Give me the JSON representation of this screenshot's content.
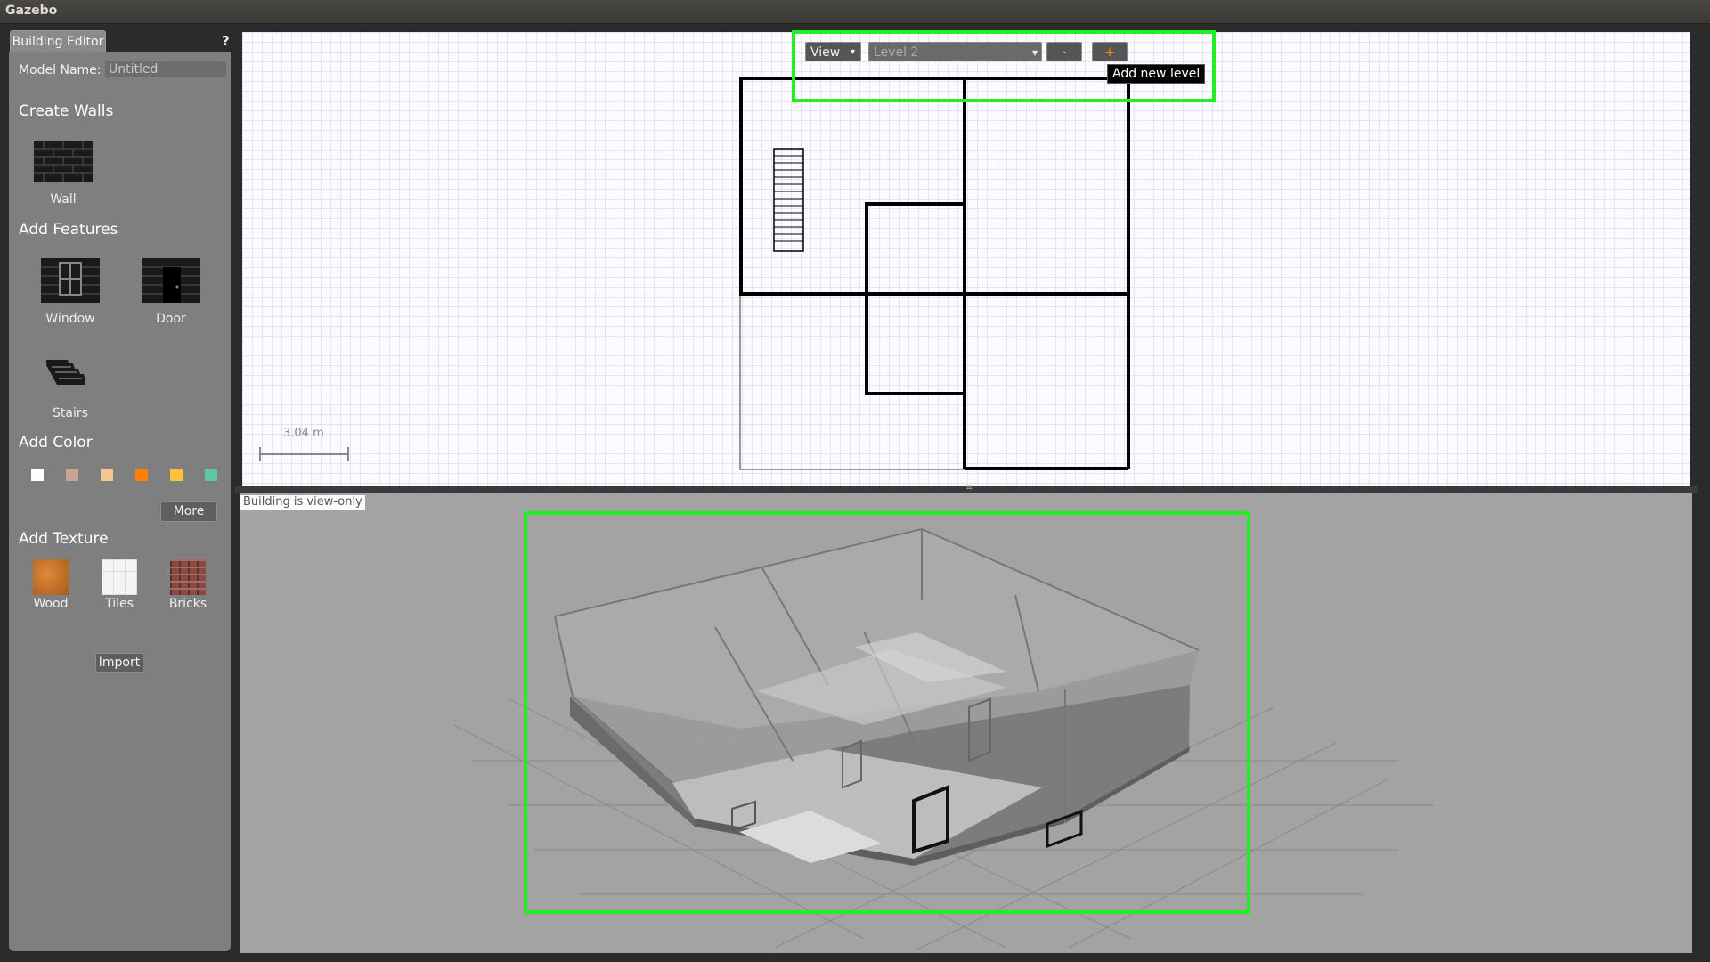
{
  "window": {
    "title": "Gazebo"
  },
  "editor": {
    "tab_label": "Building Editor",
    "help": "?",
    "model_name_label": "Model Name:",
    "model_name_value": "Untitled",
    "sections": {
      "create_walls": "Create Walls",
      "add_features": "Add Features",
      "add_color": "Add Color",
      "add_texture": "Add Texture"
    },
    "tools": {
      "wall": "Wall",
      "window": "Window",
      "door": "Door",
      "stairs": "Stairs"
    },
    "colors": [
      "#ffffff",
      "#c8a494",
      "#f0c890",
      "#ff8000",
      "#ffc040",
      "#60c8a0"
    ],
    "more_label": "More",
    "textures": {
      "wood": "Wood",
      "tiles": "Tiles",
      "bricks": "Bricks"
    },
    "import_label": "Import"
  },
  "view2d": {
    "view_menu": "View",
    "level_select": "Level 2",
    "remove_level": "-",
    "add_level": "+",
    "tooltip": "Add new level",
    "scale_label": "3.04 m"
  },
  "view3d": {
    "status": "Building is view-only"
  },
  "highlight_color": "#22ee22"
}
